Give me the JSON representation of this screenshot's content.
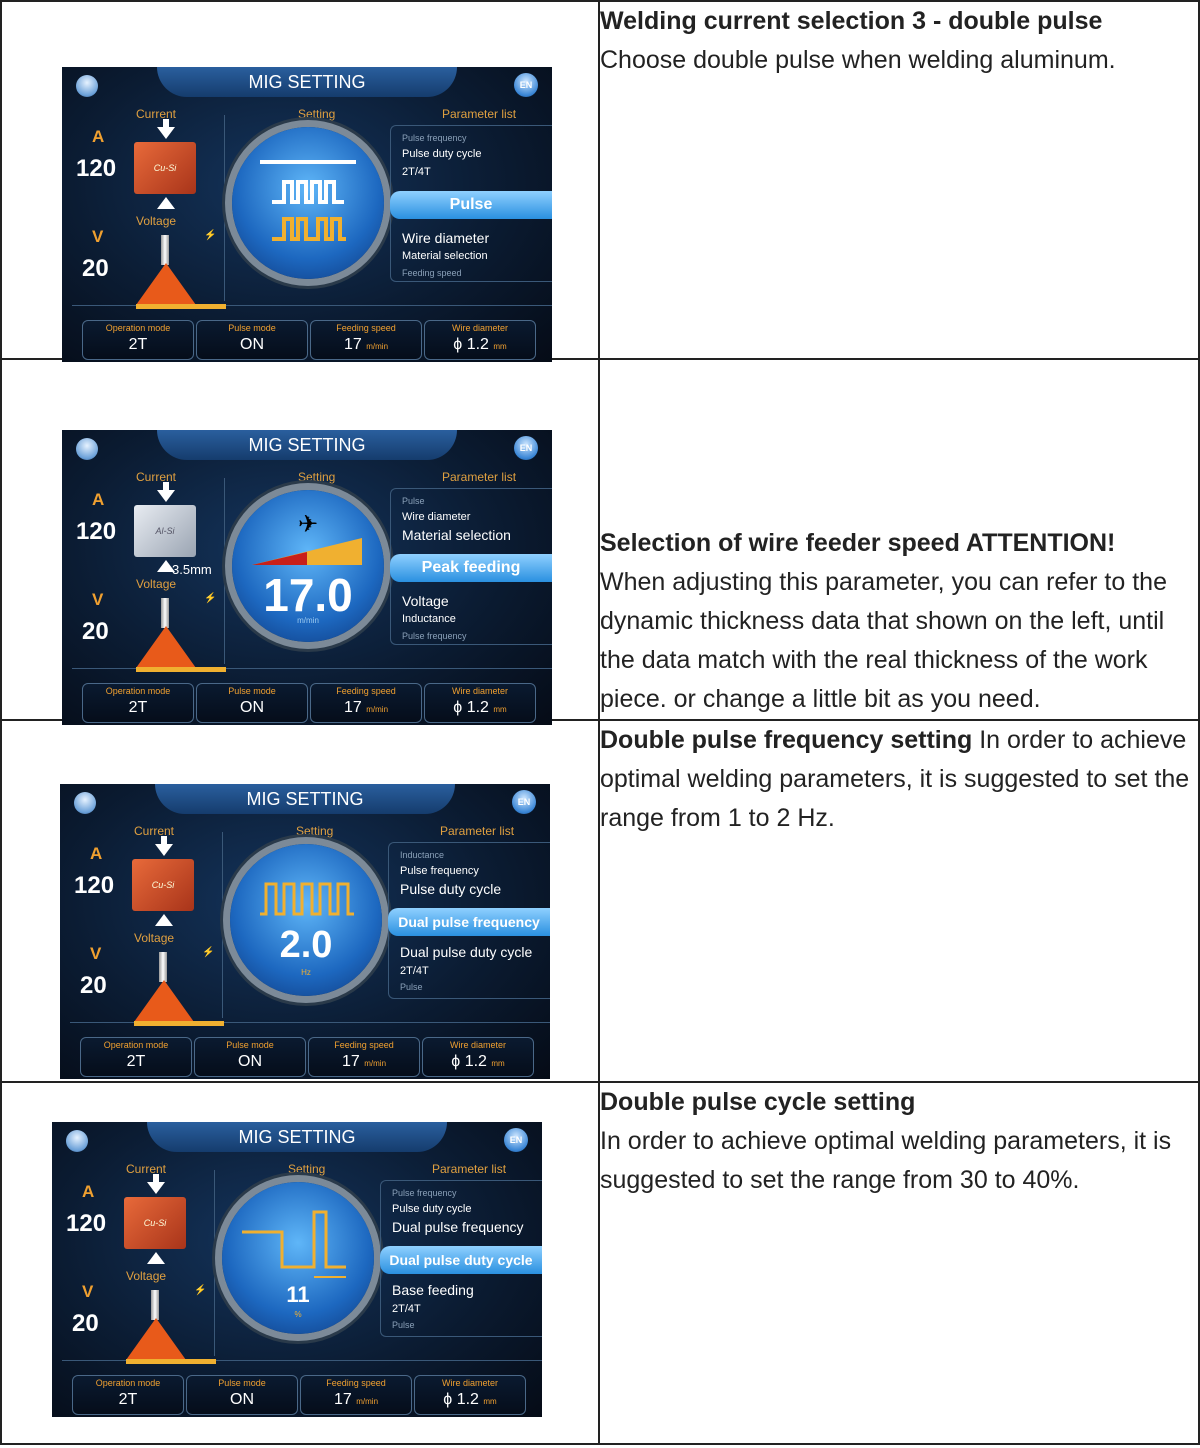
{
  "rows": [
    {
      "heading": "Welding current selection 3 - double pulse",
      "text": "Choose double pulse when welding aluminum.",
      "panel": {
        "title": "MIG SETTING",
        "lang": "EN",
        "sec_current": "Current",
        "sec_setting": "Setting",
        "sec_params": "Parameter list",
        "sec_voltage": "Voltage",
        "amp_unit": "A",
        "amp_value": "120",
        "volt_unit": "V",
        "volt_value": "20",
        "material": "Cu-Si",
        "list": [
          "Pulse frequency",
          "Pulse duty cycle",
          "2T/4T",
          "Pulse",
          "Wire diameter",
          "Material selection",
          "Feeding speed"
        ],
        "bottom": [
          {
            "label": "Operation mode",
            "value": "2T",
            "unit": ""
          },
          {
            "label": "Pulse mode",
            "value": "ON",
            "unit": ""
          },
          {
            "label": "Feeding speed",
            "value": "17",
            "unit": "m/min"
          },
          {
            "label": "Wire diameter",
            "value": "ϕ 1.2",
            "unit": "mm"
          }
        ]
      }
    },
    {
      "heading": "Selection of wire feeder speed ATTENTION!",
      "text": "When adjusting this parameter, you can refer to the dynamic thickness data that shown on the left, until the data match with the real thickness of the work piece. or change a little bit as you need.",
      "panel": {
        "title": "MIG SETTING",
        "lang": "EN",
        "sec_current": "Current",
        "sec_setting": "Setting",
        "sec_params": "Parameter list",
        "sec_voltage": "Voltage",
        "amp_unit": "A",
        "amp_value": "120",
        "volt_unit": "V",
        "volt_value": "20",
        "material": "Al-Si",
        "thickness": "3.5mm",
        "dial_value": "17.0",
        "dial_unit": "m/min",
        "list": [
          "Pulse",
          "Wire diameter",
          "Material selection",
          "Peak feeding",
          "Voltage",
          "Inductance",
          "Pulse frequency"
        ],
        "bottom": [
          {
            "label": "Operation mode",
            "value": "2T",
            "unit": ""
          },
          {
            "label": "Pulse mode",
            "value": "ON",
            "unit": ""
          },
          {
            "label": "Feeding speed",
            "value": "17",
            "unit": "m/min"
          },
          {
            "label": "Wire diameter",
            "value": "ϕ 1.2",
            "unit": "mm"
          }
        ]
      }
    },
    {
      "heading": "Double pulse frequency setting",
      "text": " In order to achieve optimal welding parameters, it is suggested to set the range from 1 to 2 Hz.",
      "panel": {
        "title": "MIG SETTING",
        "lang": "EN",
        "sec_current": "Current",
        "sec_setting": "Setting",
        "sec_params": "Parameter list",
        "sec_voltage": "Voltage",
        "amp_unit": "A",
        "amp_value": "120",
        "volt_unit": "V",
        "volt_value": "20",
        "material": "Cu-Si",
        "dial_value": "2.0",
        "dial_unit": "Hz",
        "list": [
          "Inductance",
          "Pulse frequency",
          "Pulse duty cycle",
          "Dual pulse frequency",
          "Dual pulse duty cycle",
          "2T/4T",
          "Pulse"
        ],
        "bottom": [
          {
            "label": "Operation mode",
            "value": "2T",
            "unit": ""
          },
          {
            "label": "Pulse mode",
            "value": "ON",
            "unit": ""
          },
          {
            "label": "Feeding speed",
            "value": "17",
            "unit": "m/min"
          },
          {
            "label": "Wire diameter",
            "value": "ϕ 1.2",
            "unit": "mm"
          }
        ]
      }
    },
    {
      "heading": "Double pulse cycle setting",
      "text": "In order to achieve optimal welding parameters, it is suggested to set the range from 30 to 40%.",
      "panel": {
        "title": "MIG SETTING",
        "lang": "EN",
        "sec_current": "Current",
        "sec_setting": "Setting",
        "sec_params": "Parameter list",
        "sec_voltage": "Voltage",
        "amp_unit": "A",
        "amp_value": "120",
        "volt_unit": "V",
        "volt_value": "20",
        "material": "Cu-Si",
        "dial_value": "11",
        "dial_unit": "%",
        "list": [
          "Pulse frequency",
          "Pulse duty cycle",
          "Dual pulse frequency",
          "Dual pulse duty cycle",
          "Base feeding",
          "2T/4T",
          "Pulse"
        ],
        "bottom": [
          {
            "label": "Operation mode",
            "value": "2T",
            "unit": ""
          },
          {
            "label": "Pulse mode",
            "value": "ON",
            "unit": ""
          },
          {
            "label": "Feeding speed",
            "value": "17",
            "unit": "m/min"
          },
          {
            "label": "Wire diameter",
            "value": "ϕ 1.2",
            "unit": "mm"
          }
        ]
      }
    }
  ],
  "colors": {
    "accent_orange": "#f0a030",
    "highlight_blue": "#2a90e0",
    "panel_bg": "#0b1c33"
  }
}
